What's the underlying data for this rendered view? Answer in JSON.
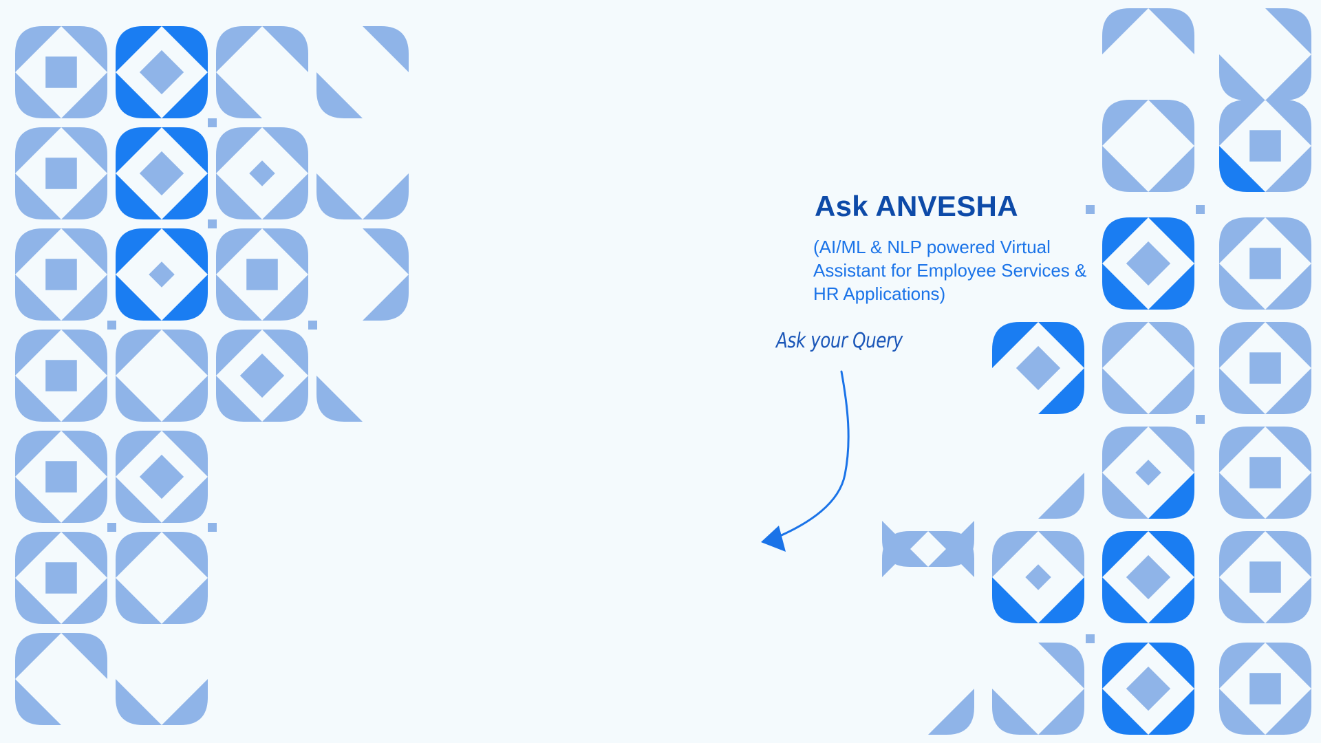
{
  "assistant": {
    "title": "Ask ANVESHA",
    "subtitle": "(AI/ML & NLP powered Virtual Assistant for Employee Services & HR Applications)",
    "hint": "Ask your Query"
  },
  "colors": {
    "background": "#f4fafd",
    "tile_light": "#8fb4e8",
    "tile_bright": "#1a7df2",
    "title": "#0d4aa8",
    "subtitle": "#1a73e8",
    "arrow": "#1a73e8"
  },
  "icons": {
    "arrow": "curved-arrow-down-left"
  }
}
